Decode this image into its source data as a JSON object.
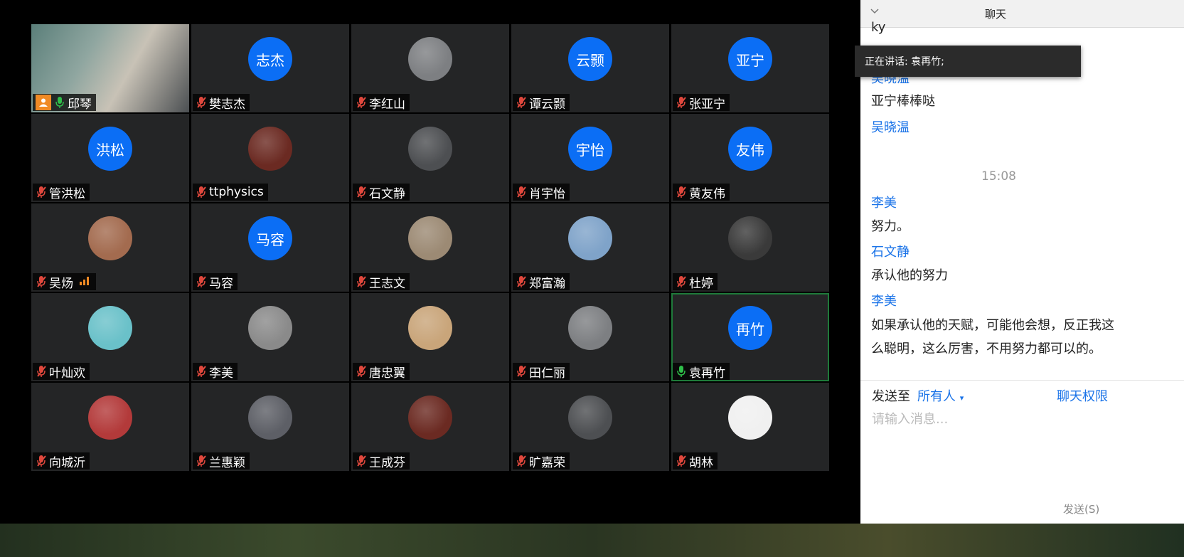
{
  "speaking_banner": {
    "label": "正在讲话: 袁再竹;"
  },
  "participants": [
    {
      "name": "邱琴",
      "avatar": "video",
      "host": true,
      "mic": "on"
    },
    {
      "name": "樊志杰",
      "avatar": "initials",
      "initials": "志杰",
      "mic": "muted"
    },
    {
      "name": "李红山",
      "avatar": "photo",
      "mic": "muted"
    },
    {
      "name": "谭云颢",
      "avatar": "initials",
      "initials": "云颢",
      "mic": "muted"
    },
    {
      "name": "张亚宁",
      "avatar": "initials",
      "initials": "亚宁",
      "mic": "muted"
    },
    {
      "name": "管洪松",
      "avatar": "initials",
      "initials": "洪松",
      "mic": "muted"
    },
    {
      "name": "ttphysics",
      "avatar": "photo",
      "mic": "muted"
    },
    {
      "name": "石文静",
      "avatar": "photo",
      "mic": "muted"
    },
    {
      "name": "肖宇怡",
      "avatar": "initials",
      "initials": "宇怡",
      "mic": "muted"
    },
    {
      "name": "黄友伟",
      "avatar": "initials",
      "initials": "友伟",
      "mic": "muted"
    },
    {
      "name": "吴炀",
      "avatar": "photo",
      "mic": "muted",
      "signal": true
    },
    {
      "name": "马容",
      "avatar": "initials",
      "initials": "马容",
      "mic": "muted"
    },
    {
      "name": "王志文",
      "avatar": "photo",
      "mic": "muted"
    },
    {
      "name": "郑富瀚",
      "avatar": "photo",
      "mic": "muted"
    },
    {
      "name": "杜婷",
      "avatar": "photo",
      "mic": "muted"
    },
    {
      "name": "叶灿欢",
      "avatar": "photo",
      "mic": "muted"
    },
    {
      "name": "李美",
      "avatar": "photo",
      "mic": "muted"
    },
    {
      "name": "唐忠翼",
      "avatar": "photo",
      "mic": "muted"
    },
    {
      "name": "田仁丽",
      "avatar": "photo",
      "mic": "muted"
    },
    {
      "name": "袁再竹",
      "avatar": "initials",
      "initials": "再竹",
      "mic": "on",
      "speaking": true
    },
    {
      "name": "向城沂",
      "avatar": "photo",
      "mic": "muted"
    },
    {
      "name": "兰惠颖",
      "avatar": "photo",
      "mic": "muted"
    },
    {
      "name": "王成芬",
      "avatar": "photo",
      "mic": "muted"
    },
    {
      "name": "旷嘉荣",
      "avatar": "photo",
      "mic": "muted"
    },
    {
      "name": "胡林",
      "avatar": "photo",
      "mic": "muted"
    }
  ],
  "chat": {
    "title": "聊天",
    "partial_top": "ky",
    "messages": [
      {
        "sender": "吴晓温",
        "text": "亚宁棒棒哒"
      },
      {
        "sender": "吴晓温",
        "text": ""
      }
    ],
    "time": "15:08",
    "messages2": [
      {
        "sender": "李美",
        "text": "努力。"
      },
      {
        "sender": "石文静",
        "text": "承认他的努力"
      },
      {
        "sender": "李美",
        "text": "如果承认他的天赋，可能他会想，反正我这",
        "text2": "么聪明，这么厉害，不用努力都可以的。"
      }
    ],
    "send_to_label": "发送至",
    "send_to_target": "所有人",
    "permission": "聊天权限",
    "input_placeholder": "请输入消息...",
    "send_button": "发送(S)"
  },
  "colors": {
    "accent": "#0b6ef5",
    "host_badge": "#f08a24",
    "mic_on": "#2fbf4a",
    "mic_muted": "#e0483d"
  }
}
